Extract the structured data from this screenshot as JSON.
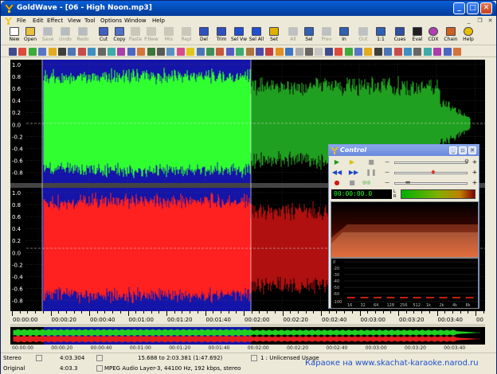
{
  "window": {
    "title": "GoldWave - [06 - High Noon.mp3]"
  },
  "menu": {
    "items": [
      "File",
      "Edit",
      "Effect",
      "View",
      "Tool",
      "Options",
      "Window",
      "Help"
    ]
  },
  "toolbar": {
    "buttons": [
      {
        "label": "New",
        "icon": "new-file-icon",
        "enabled": true
      },
      {
        "label": "Open",
        "icon": "open-folder-icon",
        "enabled": true
      },
      {
        "label": "Save",
        "icon": "save-disk-icon",
        "enabled": false
      },
      {
        "label": "Undo",
        "icon": "undo-icon",
        "enabled": false
      },
      {
        "label": "Redo",
        "icon": "redo-icon",
        "enabled": false
      },
      {
        "label": "Cut",
        "icon": "scissors-icon",
        "enabled": true
      },
      {
        "label": "Copy",
        "icon": "copy-icon",
        "enabled": true
      },
      {
        "label": "Paste",
        "icon": "paste-icon",
        "enabled": false
      },
      {
        "label": "P.New",
        "icon": "paste-new-icon",
        "enabled": false
      },
      {
        "label": "Mix",
        "icon": "mix-icon",
        "enabled": false
      },
      {
        "label": "Repl",
        "icon": "replace-icon",
        "enabled": false
      },
      {
        "label": "Del",
        "icon": "delete-icon",
        "enabled": true
      },
      {
        "label": "Trim",
        "icon": "trim-icon",
        "enabled": true
      },
      {
        "label": "Sel Vw",
        "icon": "select-view-icon",
        "enabled": true
      },
      {
        "label": "Sel All",
        "icon": "select-all-icon",
        "enabled": true
      },
      {
        "label": "Set",
        "icon": "set-marker-icon",
        "enabled": true
      },
      {
        "label": "All",
        "icon": "zoom-all-icon",
        "enabled": false
      },
      {
        "label": "Sel",
        "icon": "zoom-sel-icon",
        "enabled": true
      },
      {
        "label": "Prev",
        "icon": "zoom-prev-icon",
        "enabled": false
      },
      {
        "label": "In",
        "icon": "zoom-in-icon",
        "enabled": true
      },
      {
        "label": "Out",
        "icon": "zoom-out-icon",
        "enabled": false
      },
      {
        "label": "1:1",
        "icon": "zoom-actual-icon",
        "enabled": true
      },
      {
        "label": "Cues",
        "icon": "cues-icon",
        "enabled": true
      },
      {
        "label": "Eval",
        "icon": "eval-icon",
        "enabled": true
      },
      {
        "label": "CDX",
        "icon": "cd-icon",
        "enabled": true
      },
      {
        "label": "Chain",
        "icon": "chain-icon",
        "enabled": true
      },
      {
        "label": "Help",
        "icon": "help-icon",
        "enabled": true
      }
    ]
  },
  "wave": {
    "top_labels": [
      "1.0",
      "0.8",
      "0.6",
      "0.4",
      "0.2",
      "0.0",
      "-0.2",
      "-0.4",
      "-0.6",
      "-0.8"
    ],
    "bottom_labels": [
      "1.0",
      "0.8",
      "0.6",
      "0.4",
      "0.2",
      "0.0",
      "-0.2",
      "-0.4",
      "-0.6",
      "-0.8"
    ]
  },
  "timeline": {
    "ticks": [
      "00:00:00",
      "00:00:20",
      "00:00:40",
      "00:01:00",
      "00:01:20",
      "00:01:40",
      "00:02:00",
      "00:02:20",
      "00:02:40",
      "00:03:00",
      "00:03:20",
      "00:03:40",
      "00"
    ]
  },
  "timeline2": {
    "ticks": [
      "00:00:00",
      "00:00:20",
      "00:00:40",
      "00:01:00",
      "00:01:20",
      "00:01:40",
      "00:02:00",
      "00:02:20",
      "00:02:40",
      "00:03:00",
      "00:03:20",
      "00:03:40"
    ]
  },
  "status": {
    "row1": {
      "channel": "Stereo",
      "duration": "4:03.304",
      "selection": "15.688 to 2:03.381 (1:47.692)",
      "usage": "1 : Unlicensed Usage"
    },
    "row2": {
      "label": "Original",
      "duration": "4:03.3",
      "format": "MPEG Audio Layer-3, 44100 Hz, 192 kbps, stereo"
    }
  },
  "watermark": "Караоке на www.skachat-karaoke.narod.ru",
  "control": {
    "title": "Control",
    "counter": "00:00:00.0",
    "meter_labels": [
      "L",
      "R"
    ],
    "analyzer_y": [
      "0",
      "-20",
      "-30",
      "-40",
      "-50",
      "-60",
      "-100"
    ],
    "analyzer_x": [
      "16",
      "32",
      "64",
      "128",
      "256",
      "512",
      "1k",
      "2k",
      "4k",
      "8k"
    ]
  }
}
